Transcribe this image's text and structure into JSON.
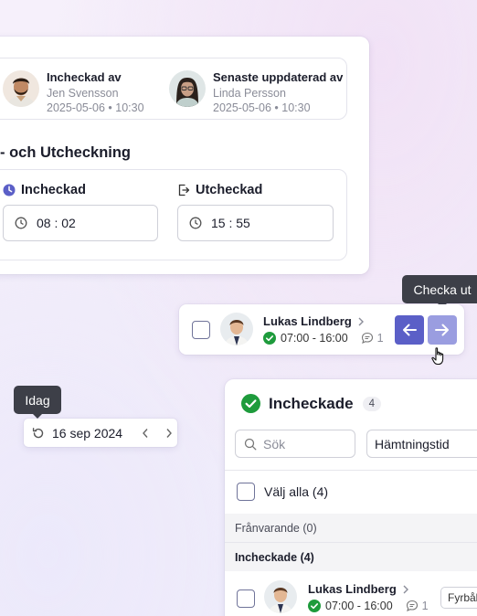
{
  "top_card": {
    "checked_in_by": {
      "title": "Incheckad av",
      "name": "Jen Svensson",
      "time": "2025-05-06 • 10:30"
    },
    "updated_by": {
      "title": "Senaste uppdaterad av",
      "name": "Linda Persson",
      "time": "2025-05-06 • 10:30"
    },
    "section_title": "- och Utcheckning",
    "check_in": {
      "label": "Incheckad",
      "time": "08 : 02"
    },
    "check_out": {
      "label": "Utcheckad",
      "time": "15 : 55"
    }
  },
  "checkout_tooltip": "Checka ut",
  "child_card": {
    "name": "Lukas Lindberg",
    "schedule": "07:00 - 16:00",
    "comment_count": "1"
  },
  "today_tooltip": "Idag",
  "date_picker": {
    "date": "16 sep 2024"
  },
  "list_panel": {
    "title": "Incheckade",
    "count": "4",
    "search_placeholder": "Sök",
    "sort_value": "Hämtningstid",
    "select_all": "Välj alla (4)",
    "groups": [
      {
        "label": "Frånvarande (0)"
      },
      {
        "label": "Incheckade (4)"
      }
    ],
    "rows": [
      {
        "name": "Lukas Lindberg",
        "schedule": "07:00 - 16:00",
        "comment_count": "1",
        "tag": "Fyrbål"
      }
    ]
  },
  "colors": {
    "accent": "#5b5fc7",
    "accent_light": "#9a9de0",
    "success": "#1e9b3c",
    "tooltip_bg": "#3d3f48"
  }
}
